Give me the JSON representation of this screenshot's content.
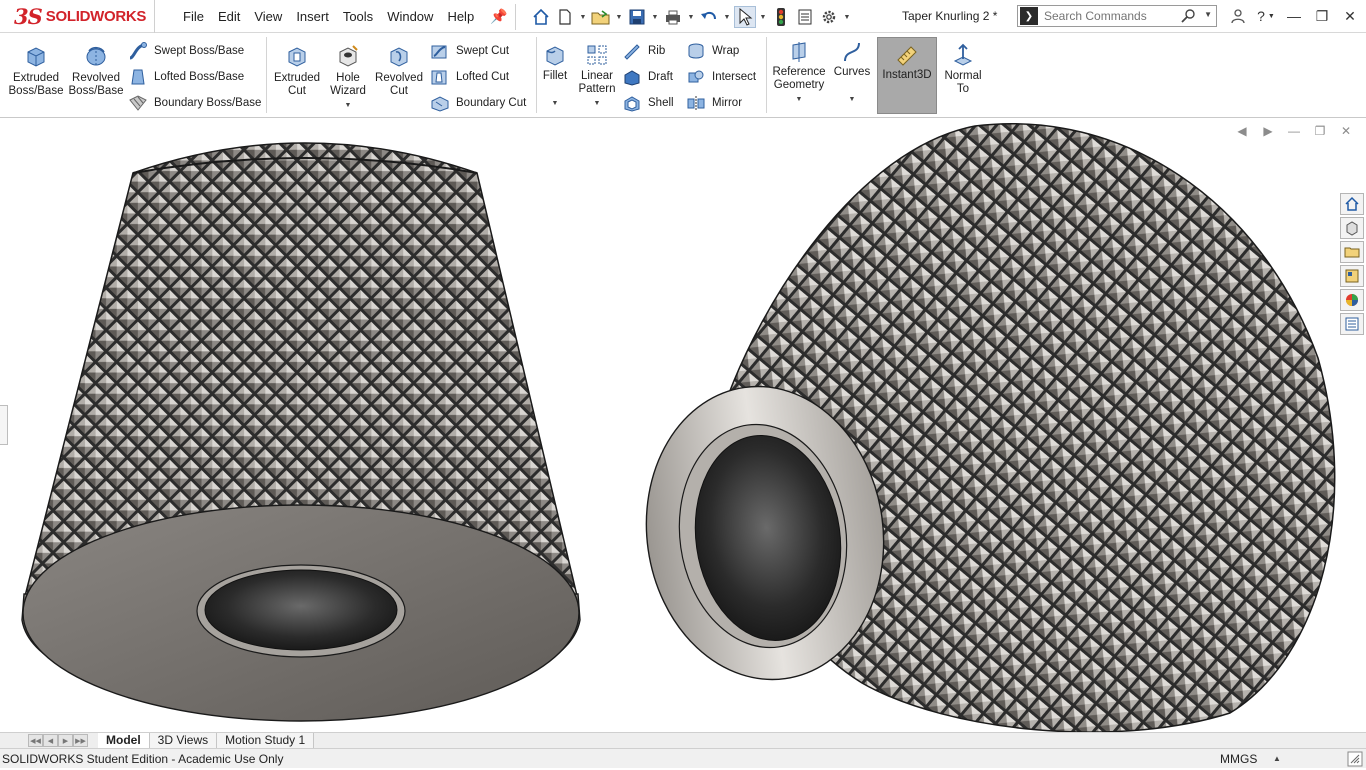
{
  "app": {
    "logo_ds": "3S",
    "logo_brand": "SOLIDWORKS",
    "document_title": "Taper Knurling 2 *"
  },
  "menu": [
    "File",
    "Edit",
    "View",
    "Insert",
    "Tools",
    "Window",
    "Help"
  ],
  "search": {
    "placeholder": "Search Commands"
  },
  "features": {
    "extruded_boss": "Extruded\nBoss/Base",
    "revolved_boss": "Revolved\nBoss/Base",
    "swept_boss": "Swept Boss/Base",
    "lofted_boss": "Lofted Boss/Base",
    "boundary_boss": "Boundary Boss/Base",
    "extruded_cut": "Extruded\nCut",
    "hole_wizard": "Hole\nWizard",
    "revolved_cut": "Revolved\nCut",
    "swept_cut": "Swept Cut",
    "lofted_cut": "Lofted Cut",
    "boundary_cut": "Boundary Cut",
    "fillet": "Fillet",
    "linear_pattern": "Linear\nPattern",
    "rib": "Rib",
    "draft": "Draft",
    "shell": "Shell",
    "wrap": "Wrap",
    "intersect": "Intersect",
    "mirror": "Mirror",
    "reference_geometry": "Reference\nGeometry",
    "curves": "Curves",
    "instant3d": "Instant3D",
    "normal_to": "Normal\nTo"
  },
  "tabs": [
    "Model",
    "3D Views",
    "Motion Study 1"
  ],
  "active_tab": "Model",
  "status": {
    "left": "SOLIDWORKS Student Edition - Academic Use Only",
    "units": "MMGS"
  },
  "colors": {
    "brand_red": "#d2232a",
    "model_gray": "#7a7672",
    "accent_blue": "#2a6cc4"
  }
}
